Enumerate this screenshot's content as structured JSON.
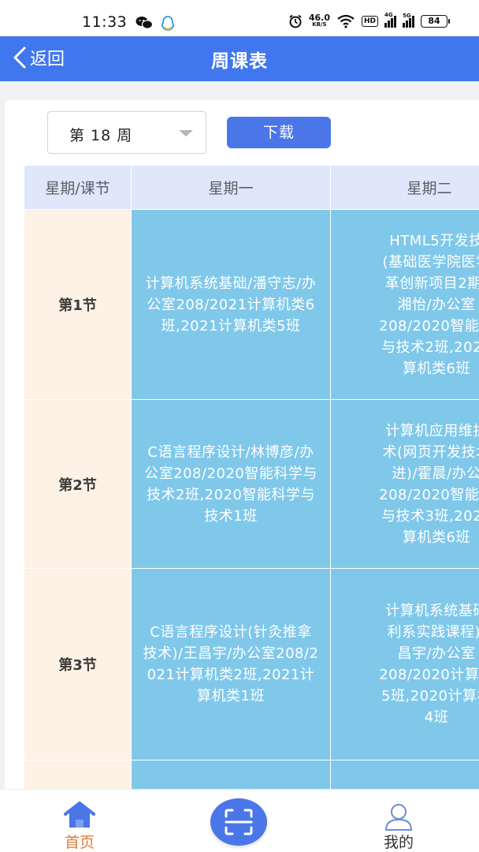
{
  "status_bar": {
    "time": "11:33",
    "net_speed": "46.0",
    "net_unit": "KB/S",
    "hd_badge": "HD",
    "signal1_label": "4G",
    "signal2_label": "5G",
    "battery": "84"
  },
  "header": {
    "back_label": "返回",
    "title": "周课表"
  },
  "controls": {
    "week_select": "第 18 周",
    "download_label": "下载"
  },
  "table": {
    "corner_header": "星期/课节",
    "day_headers": [
      "星期一",
      "星期二"
    ],
    "rows": [
      {
        "period": "第1节",
        "mon": "计算机系统基础/潘守志/办公室208/2021计算机类6班,2021计算机类5班",
        "tue": "HTML5开发技\n(基础医学院医学\n革创新项目2期)\n湘怡/办公室\n208/2020智能和\n与技术2班,2020\n算机类6班"
      },
      {
        "period": "第2节",
        "mon": "C语言程序设计/林博彦/办公室208/2020智能科学与技术2班,2020智能科学与技术1班",
        "tue": "计算机应用维折\n术(网页开发技术\n进)/霍晨/办公\n208/2020智能和\n与技术3班,2020\n算机类6班"
      },
      {
        "period": "第3节",
        "mon": "C语言程序设计(针灸推拿技术)/王昌宇/办公室208/2021计算机类2班,2021计算机类1班",
        "tue": "计算机系统基础\n利系实践课程)/\n昌宇/办公室\n208/2020计算机\n5班,2020计算机\n4班"
      },
      {
        "period": "",
        "mon": "",
        "tue": ""
      }
    ]
  },
  "bottom_nav": {
    "home_label": "首页",
    "mine_label": "我的"
  },
  "colors": {
    "header_blue": "#4177ee",
    "button_blue": "#4a76e8",
    "course_cell": "#80c8ea",
    "period_cell": "#fdf2e5",
    "table_header": "#dfe7fb",
    "active_tab": "#e07a3a"
  },
  "icons": {
    "back": "chevron-left-icon",
    "dropdown": "caret-down-icon",
    "home": "home-icon",
    "scan": "scan-icon",
    "mine": "user-icon"
  }
}
